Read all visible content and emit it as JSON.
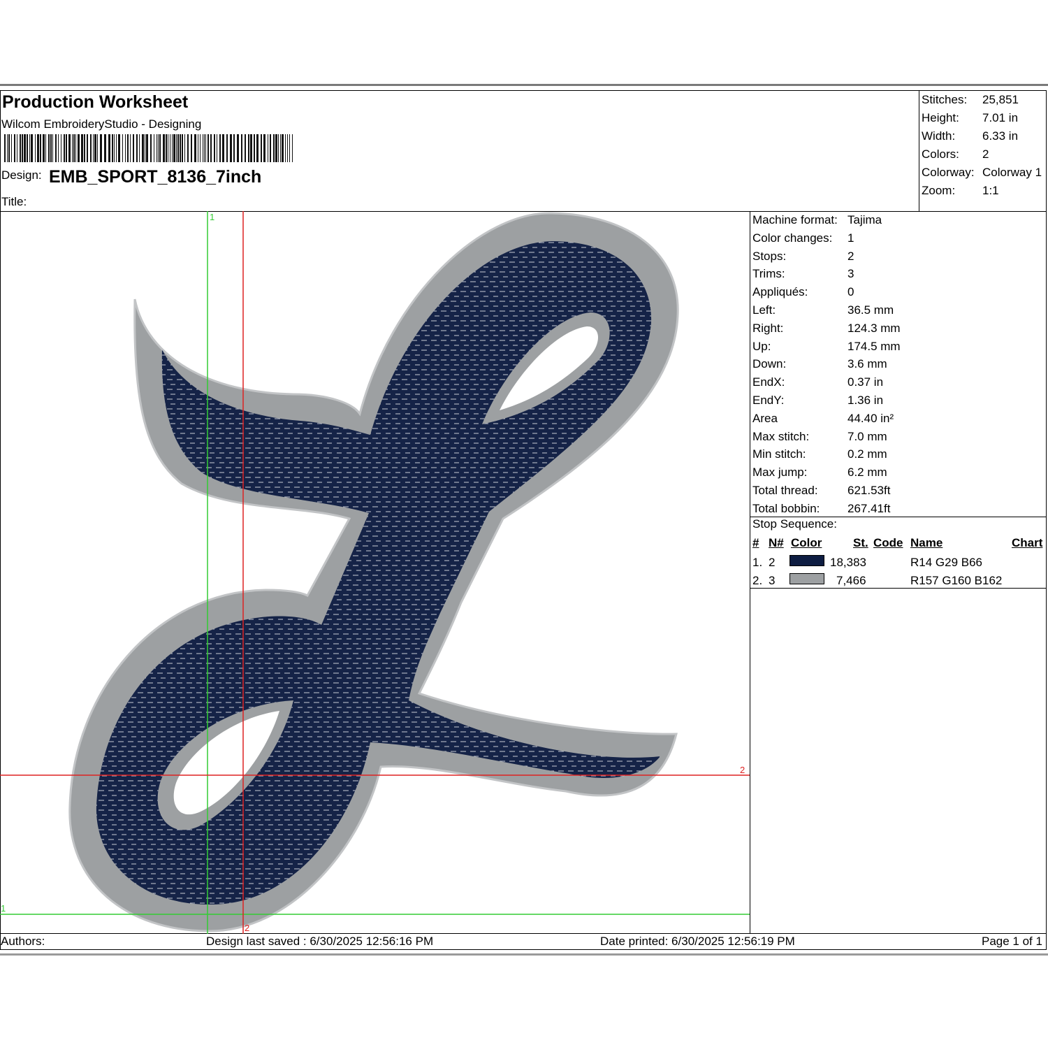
{
  "header": {
    "title": "Production Worksheet",
    "subtitle": "Wilcom EmbroideryStudio - Designing",
    "design_label": "Design:",
    "design_value": "EMB_SPORT_8136_7inch",
    "title_label": "Title:"
  },
  "summary": [
    {
      "key": "Stitches:",
      "value": "25,851"
    },
    {
      "key": "Height:",
      "value": "7.01 in"
    },
    {
      "key": "Width:",
      "value": "6.33 in"
    },
    {
      "key": "Colors:",
      "value": "2"
    },
    {
      "key": "Colorway:",
      "value": "Colorway 1"
    },
    {
      "key": "Zoom:",
      "value": "1:1"
    }
  ],
  "stats": [
    {
      "key": "Machine format:",
      "value": "Tajima"
    },
    {
      "key": "Color changes:",
      "value": "1"
    },
    {
      "key": "Stops:",
      "value": "2"
    },
    {
      "key": "Trims:",
      "value": "3"
    },
    {
      "key": "Appliqués:",
      "value": "0"
    },
    {
      "key": "Left:",
      "value": "36.5 mm"
    },
    {
      "key": "Right:",
      "value": "124.3 mm"
    },
    {
      "key": "Up:",
      "value": "174.5 mm"
    },
    {
      "key": "Down:",
      "value": "3.6 mm"
    },
    {
      "key": "EndX:",
      "value": "0.37 in"
    },
    {
      "key": "EndY:",
      "value": "1.36 in"
    },
    {
      "key": "Area",
      "value": " 44.40 in²"
    },
    {
      "key": "Max stitch:",
      "value": "7.0 mm"
    },
    {
      "key": "Min stitch:",
      "value": "0.2 mm"
    },
    {
      "key": "Max jump:",
      "value": "6.2 mm"
    },
    {
      "key": "Total thread:",
      "value": "621.53ft"
    },
    {
      "key": "Total bobbin:",
      "value": "267.41ft"
    }
  ],
  "stop_sequence": {
    "label": "Stop Sequence:",
    "headers": {
      "num": "#",
      "needle": "N#",
      "color": "Color",
      "stitches": "St.",
      "code": "Code",
      "name": "Name",
      "chart": "Chart"
    },
    "rows": [
      {
        "num": "1.",
        "needle": "2",
        "swatch": "#0e1d42",
        "stitches": "18,383",
        "name": "R14 G29 B66"
      },
      {
        "num": "2.",
        "needle": "3",
        "swatch": "#9da0a2",
        "stitches": "7,466",
        "name": "R157 G160 B162"
      }
    ]
  },
  "canvas": {
    "guide_x_label": "1",
    "guide_y_label": "1",
    "origin_x_label": "2",
    "origin_y_label": "2",
    "fill_color": "#152347",
    "border_color": "#9da0a2",
    "green_guide": "#33cc33",
    "red_guide": "#dd2222"
  },
  "footer": {
    "authors": "Authors:",
    "saved": "Design last saved : 6/30/2025 12:56:16 PM",
    "printed": "Date printed: 6/30/2025 12:56:19 PM",
    "page": "Page 1 of 1"
  }
}
